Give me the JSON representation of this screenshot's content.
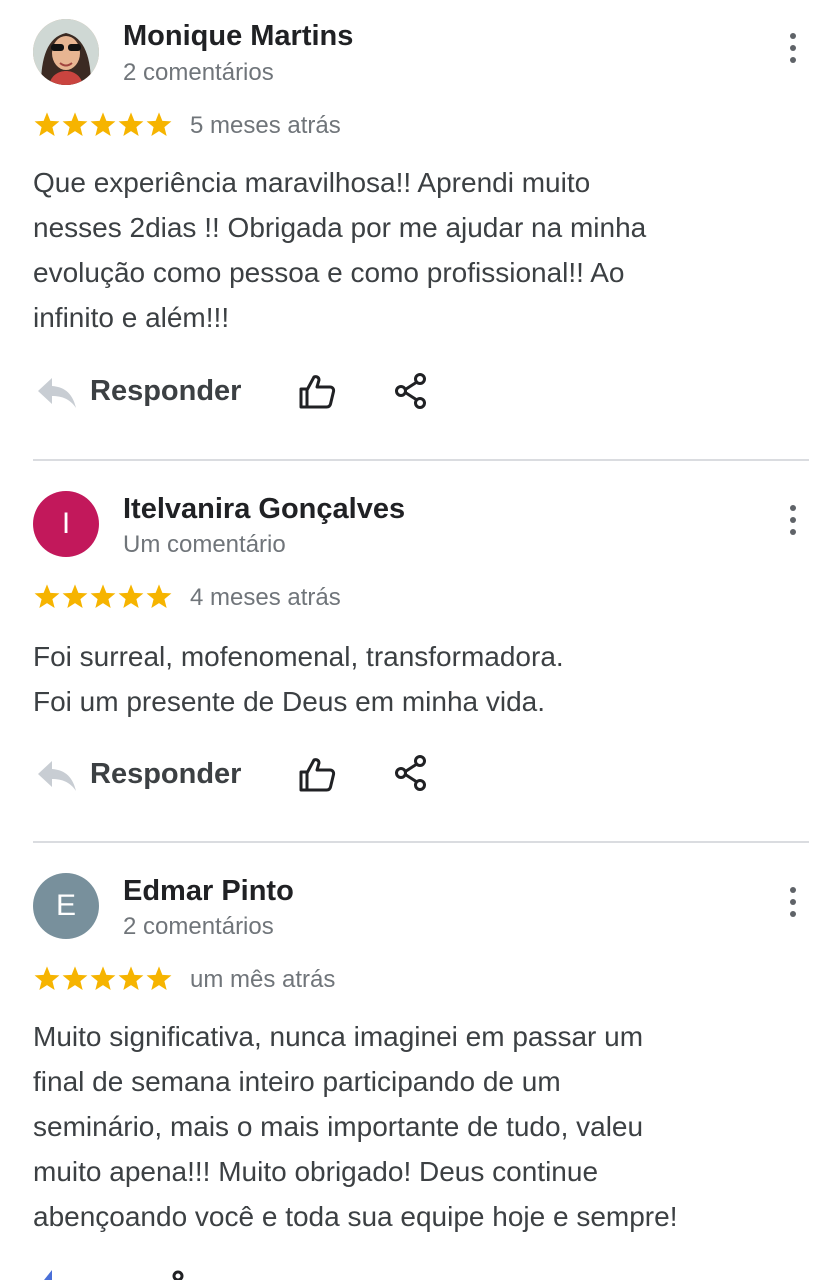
{
  "reviews": [
    {
      "name": "Monique Martins",
      "count": "2 comentários",
      "rating": 5,
      "date": "5 meses atrás",
      "text_lines": [
        "Que experiência maravilhosa!! Aprendi muito",
        "nesses 2dias !! Obrigada por me ajudar na minha",
        "evolução como pessoa e como profissional!! Ao",
        "infinito e além!!!"
      ],
      "reply_label": "Responder",
      "avatar_kind": "photo"
    },
    {
      "name": "Itelvanira Gonçalves",
      "count": "Um comentário",
      "rating": 5,
      "date": "4 meses atrás",
      "text_lines": [
        "Foi surreal, mofenomenal, transformadora.",
        "Foi um presente de Deus em minha vida."
      ],
      "reply_label": "Responder",
      "avatar_initial": "I",
      "avatar_color": "#c2185b"
    },
    {
      "name": "Edmar Pinto",
      "count": "2 comentários",
      "rating": 5,
      "date": "um mês atrás",
      "text_lines": [
        "Muito significativa, nunca imaginei em passar um",
        "final de semana inteiro participando de um",
        "seminário, mais o mais importante de tudo, valeu",
        "muito apena!!! Muito obrigado! Deus continue",
        "abençoando você e toda sua equipe hoje e sempre!"
      ],
      "avatar_initial": "E",
      "avatar_color": "#78909c"
    }
  ],
  "colors": {
    "star": "#f6b400",
    "icon": "#5f6368",
    "reply_icon": "#c8cdd3"
  },
  "icons": [
    "reply-icon",
    "thumbs-up-icon",
    "share-icon",
    "more-vert-icon",
    "star-icon"
  ]
}
